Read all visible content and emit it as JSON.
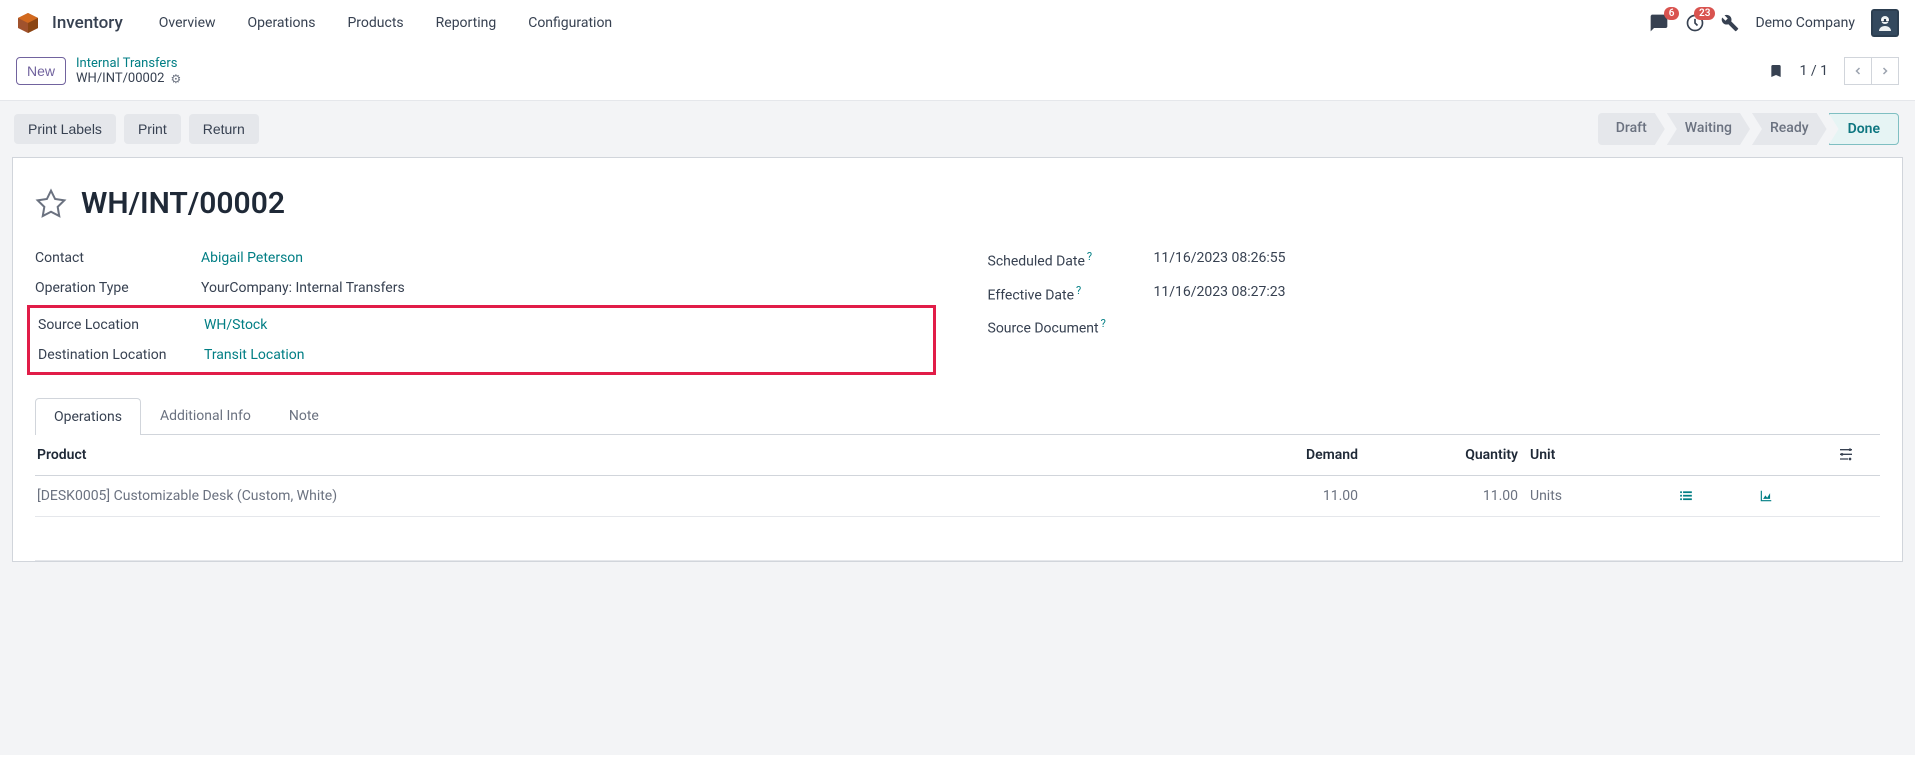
{
  "app": {
    "title": "Inventory"
  },
  "nav": {
    "links": [
      "Overview",
      "Operations",
      "Products",
      "Reporting",
      "Configuration"
    ]
  },
  "topbar": {
    "messages_badge": "6",
    "activities_badge": "23",
    "company": "Demo Company"
  },
  "breadcrumb": {
    "new_label": "New",
    "parent": "Internal Transfers",
    "current": "WH/INT/00002",
    "pager": "1 / 1"
  },
  "actions": {
    "print_labels": "Print Labels",
    "print": "Print",
    "return": "Return"
  },
  "status": {
    "draft": "Draft",
    "waiting": "Waiting",
    "ready": "Ready",
    "done": "Done"
  },
  "record": {
    "title": "WH/INT/00002",
    "fields": {
      "contact_label": "Contact",
      "contact_value": "Abigail Peterson",
      "operation_type_label": "Operation Type",
      "operation_type_value": "YourCompany: Internal Transfers",
      "source_location_label": "Source Location",
      "source_location_value": "WH/Stock",
      "destination_location_label": "Destination Location",
      "destination_location_value": "Transit Location",
      "scheduled_date_label": "Scheduled Date",
      "scheduled_date_value": "11/16/2023 08:26:55",
      "effective_date_label": "Effective Date",
      "effective_date_value": "11/16/2023 08:27:23",
      "source_document_label": "Source Document"
    }
  },
  "tabs": {
    "operations": "Operations",
    "additional_info": "Additional Info",
    "note": "Note"
  },
  "table": {
    "headers": {
      "product": "Product",
      "demand": "Demand",
      "quantity": "Quantity",
      "unit": "Unit"
    },
    "rows": [
      {
        "product": "[DESK0005] Customizable Desk (Custom, White)",
        "demand": "11.00",
        "quantity": "11.00",
        "unit": "Units"
      }
    ]
  }
}
